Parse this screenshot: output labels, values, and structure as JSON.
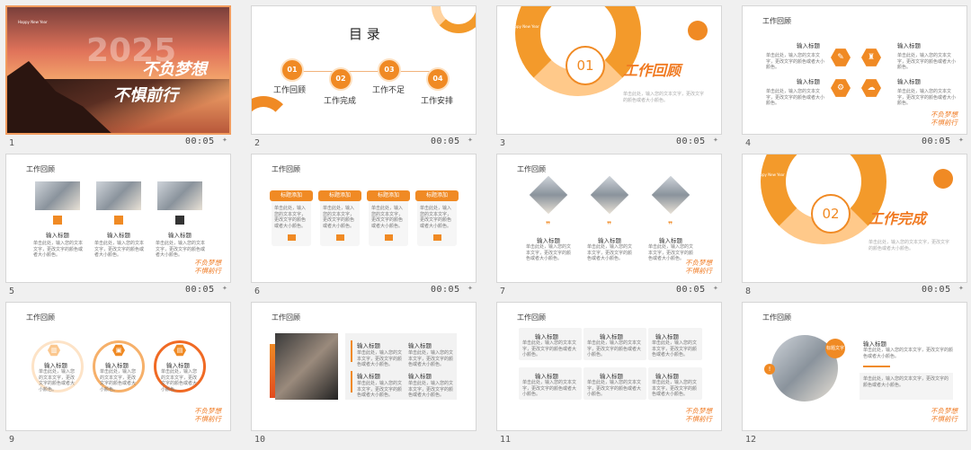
{
  "slides": [
    {
      "num": "1",
      "time": "00:05",
      "title_main": "2025",
      "line1": "不负梦想",
      "line2": "不惧前行",
      "eyebrow": "Happy New Year"
    },
    {
      "num": "2",
      "time": "00:05",
      "toc_title": "目 录",
      "items": [
        {
          "n": "01",
          "label": "工作回顾"
        },
        {
          "n": "02",
          "label": "工作完成"
        },
        {
          "n": "03",
          "label": "工作不足"
        },
        {
          "n": "04",
          "label": "工作安排"
        }
      ]
    },
    {
      "num": "3",
      "time": "00:05",
      "badge": "01",
      "section": "工作回顾",
      "eyebrow": "Happy New Year"
    },
    {
      "num": "4",
      "time": "00:05",
      "title": "工作回顾",
      "h": "输入标题",
      "brand1": "不负梦想",
      "brand2": "不惧前行"
    },
    {
      "num": "5",
      "time": "00:05",
      "title": "工作回顾",
      "h": "输入标题",
      "brand1": "不负梦想",
      "brand2": "不惧前行"
    },
    {
      "num": "6",
      "time": "00:05",
      "title": "工作回顾",
      "tab": "标题添加"
    },
    {
      "num": "7",
      "time": "00:05",
      "title": "工作回顾",
      "h": "输入标题",
      "brand1": "不负梦想",
      "brand2": "不惧前行"
    },
    {
      "num": "8",
      "time": "00:05",
      "badge": "02",
      "section": "工作完成",
      "eyebrow": "Happy New Year"
    },
    {
      "num": "9",
      "time": "",
      "title": "工作回顾",
      "h": "输入标题",
      "brand1": "不负梦想",
      "brand2": "不惧前行"
    },
    {
      "num": "10",
      "time": "",
      "title": "工作回顾",
      "h": "输入标题"
    },
    {
      "num": "11",
      "time": "",
      "title": "工作回顾",
      "h": "输入标题",
      "brand1": "不负梦想",
      "brand2": "不惧前行"
    },
    {
      "num": "12",
      "time": "",
      "title": "工作回顾",
      "h": "输入标题",
      "badge_text": "标题文字",
      "brand1": "不负梦想",
      "brand2": "不惧前行"
    }
  ],
  "placeholder": "单击此处，输入您的文本文字，更改文字的颜色或者大小颜色。"
}
